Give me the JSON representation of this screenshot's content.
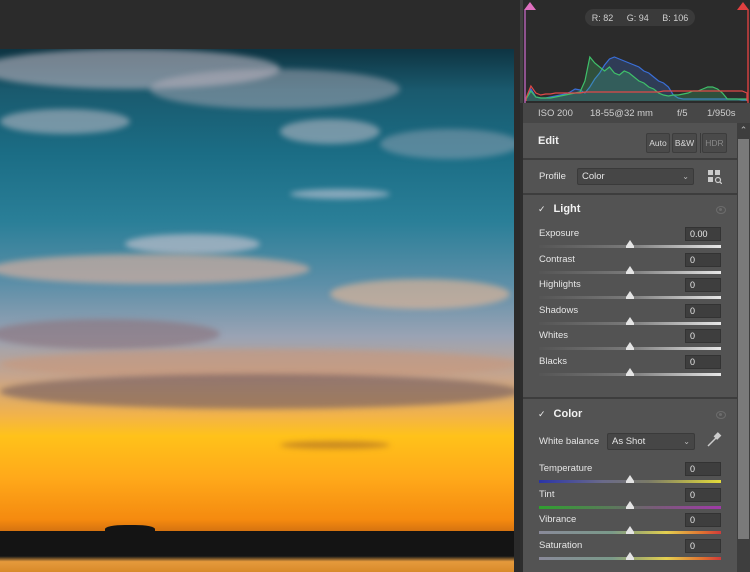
{
  "histogram": {
    "rgb": {
      "r_label": "R:",
      "r": "82",
      "g_label": "G:",
      "g": "94",
      "b_label": "B:",
      "b": "106"
    },
    "colors": {
      "red": "#e04848",
      "green": "#3fc06a",
      "blue": "#3a6fd8",
      "shadow_clip": "#e070c0",
      "highlight_clip": "#e04040"
    }
  },
  "exif": {
    "iso": "ISO 200",
    "lens": "18-55@32 mm",
    "aperture": "f/5",
    "shutter": "1/950s"
  },
  "edit": {
    "title": "Edit",
    "auto_label": "Auto",
    "bw_label": "B&W",
    "hdr_label": "HDR",
    "profile_label": "Profile",
    "profile_value": "Color"
  },
  "light": {
    "title": "Light",
    "sliders": [
      {
        "name": "Exposure",
        "value": "0.00",
        "position": 0.5
      },
      {
        "name": "Contrast",
        "value": "0",
        "position": 0.5
      },
      {
        "name": "Highlights",
        "value": "0",
        "position": 0.5
      },
      {
        "name": "Shadows",
        "value": "0",
        "position": 0.5
      },
      {
        "name": "Whites",
        "value": "0",
        "position": 0.5
      },
      {
        "name": "Blacks",
        "value": "0",
        "position": 0.5
      }
    ]
  },
  "color": {
    "title": "Color",
    "wb_label": "White balance",
    "wb_value": "As Shot",
    "sliders": [
      {
        "name": "Temperature",
        "value": "0",
        "position": 0.5
      },
      {
        "name": "Tint",
        "value": "0",
        "position": 0.5
      },
      {
        "name": "Vibrance",
        "value": "0",
        "position": 0.5
      },
      {
        "name": "Saturation",
        "value": "0",
        "position": 0.5
      }
    ]
  },
  "icons": {
    "collapse": "chevron-down-icon",
    "visibility": "eye-icon",
    "browse_profiles": "profile-browser-icon",
    "eyedropper": "eyedropper-icon",
    "scroll_up": "chevron-up-icon"
  }
}
